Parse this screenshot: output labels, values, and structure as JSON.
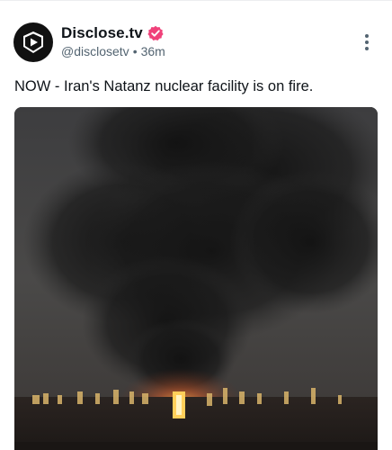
{
  "post": {
    "author": {
      "display_name": "Disclose.tv",
      "handle": "@disclosetv",
      "separator": "•",
      "time": "36m",
      "verified": true,
      "verified_color": "#f0417a",
      "avatar_icon": "play-shield-logo-icon"
    },
    "text": "NOW - Iran's Natanz nuclear facility is on fire.",
    "media": {
      "type": "image",
      "content_icon": "facility-fire-night-photo"
    },
    "menu_icon": "more-vertical-icon"
  }
}
